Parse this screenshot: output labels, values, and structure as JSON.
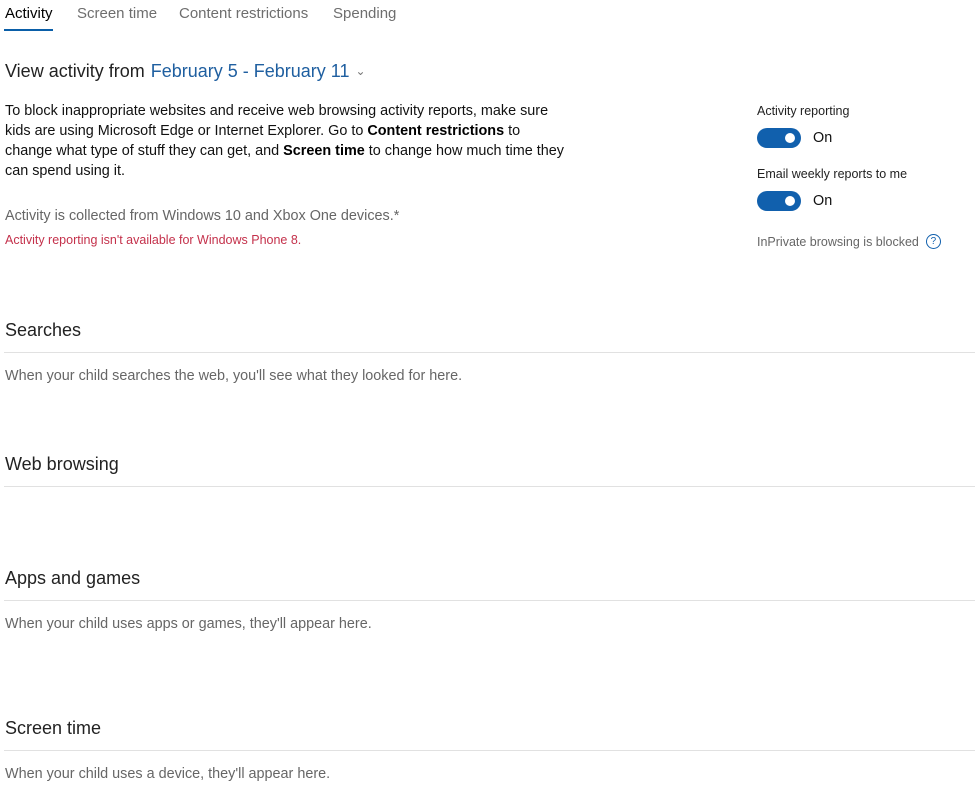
{
  "tabs": [
    {
      "label": "Activity",
      "active": true
    },
    {
      "label": "Screen time",
      "active": false
    },
    {
      "label": "Content restrictions",
      "active": false
    },
    {
      "label": "Spending",
      "active": false
    }
  ],
  "view": {
    "label": "View activity from",
    "date_range": "February 5 - February 11"
  },
  "intro": {
    "part1": "To block inappropriate websites and receive web browsing activity reports, make sure kids are using Microsoft Edge or Internet Explorer. Go to ",
    "bold1": "Content restrictions",
    "part2": " to change what type of stuff they can get, and ",
    "bold2": "Screen time",
    "part3": " to change how much time they can spend using it."
  },
  "collected_note": "Activity is collected from Windows 10 and Xbox One devices.*",
  "warning": "Activity reporting isn't available for Windows Phone 8.",
  "settings": {
    "activity_reporting": {
      "label": "Activity reporting",
      "state": "On"
    },
    "email_reports": {
      "label": "Email weekly reports to me",
      "state": "On"
    },
    "inprivate": "InPrivate browsing is blocked"
  },
  "sections": {
    "searches": {
      "title": "Searches",
      "desc": "When your child searches the web, you'll see what they looked for here."
    },
    "web": {
      "title": "Web browsing"
    },
    "apps": {
      "title": "Apps and games",
      "desc": "When your child uses apps or games, they'll appear here."
    },
    "screen": {
      "title": "Screen time",
      "desc": "When your child uses a device, they'll appear here."
    }
  },
  "colors": {
    "accent": "#1160ad",
    "link": "#1f5fa0",
    "warning": "#c4314b"
  }
}
